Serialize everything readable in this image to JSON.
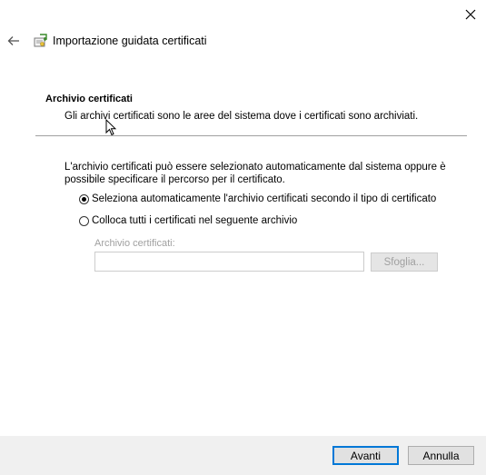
{
  "window": {
    "title": "Importazione guidata certificati"
  },
  "section": {
    "title": "Archivio certificati",
    "description": "Gli archivi certificati sono le aree del sistema dove i certificati sono archiviati."
  },
  "intro_text": "L'archivio certificati può essere selezionato automaticamente dal sistema oppure è possibile specificare il percorso per il certificato.",
  "options": [
    {
      "label": "Seleziona automaticamente l'archivio certificati secondo il tipo di certificato",
      "selected": true
    },
    {
      "label": "Colloca tutti i certificati nel seguente archivio",
      "selected": false
    }
  ],
  "store_field": {
    "label": "Archivio certificati:",
    "value": "",
    "enabled": false
  },
  "browse_button": {
    "label": "Sfoglia...",
    "enabled": false
  },
  "footer": {
    "next_label": "Avanti",
    "cancel_label": "Annulla"
  },
  "colors": {
    "accent": "#0078d7",
    "footer_bg": "#f0f0f0",
    "disabled_text": "#a0a0a0"
  },
  "icons": {
    "close": "close-icon",
    "back": "back-arrow-icon",
    "app": "certificate-icon"
  }
}
